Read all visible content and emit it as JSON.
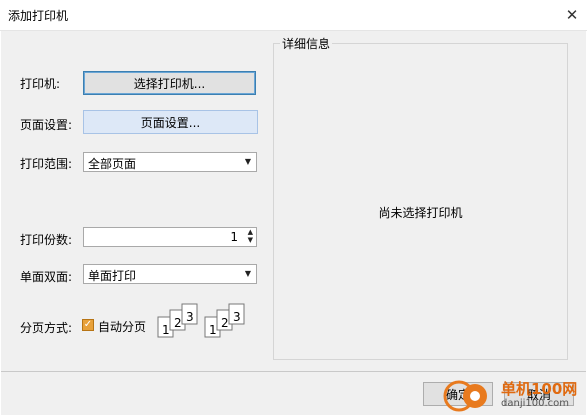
{
  "window": {
    "title": "添加打印机"
  },
  "form": {
    "printer_label": "打印机:",
    "printer_button": "选择打印机...",
    "page_label": "页面设置:",
    "page_button": "页面设置...",
    "range_label": "打印范围:",
    "range_value": "全部页面",
    "copies_label": "打印份数:",
    "copies_value": "1",
    "duplex_label": "单面双面:",
    "duplex_value": "单面打印",
    "collate_label": "分页方式:",
    "collate_checkbox_label": "自动分页",
    "collate_checked": true
  },
  "details": {
    "legend": "详细信息",
    "status": "尚未选择打印机"
  },
  "icons": {
    "collate_a_digits": [
      "1",
      "2",
      "3"
    ],
    "collate_b_digits": [
      "1",
      "2",
      "3"
    ]
  },
  "footer": {
    "ok_label": "确定",
    "cancel_label": "取消",
    "watermark_name": "单机100网",
    "watermark_url": "danji100.com"
  }
}
